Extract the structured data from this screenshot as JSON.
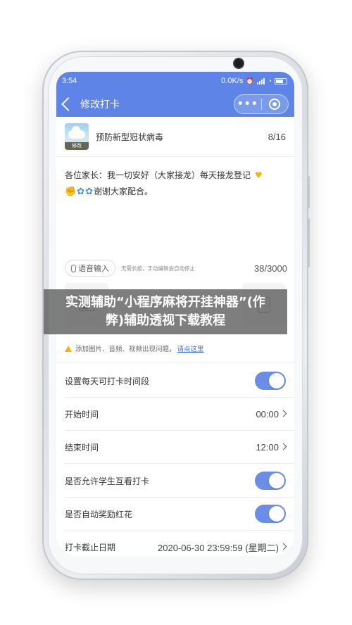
{
  "statusbar": {
    "time": "3:54",
    "network": "0.0K/s"
  },
  "header": {
    "back_icon": "chevron-left-icon",
    "title": "修改打卡",
    "more_label": "•••",
    "bg_color": "#5d84e6"
  },
  "topic": {
    "thumb_tag": "修改",
    "name": "预防新型冠状病毒",
    "count": "8/16"
  },
  "message": {
    "line1": "各位家长：我一切安好（大家接龙）每天接龙登记",
    "line2": "谢谢大家配合。"
  },
  "voice": {
    "button_label": "语音输入",
    "hint": "无需长按，手动编辑会自动停止",
    "char_count": "38/3000"
  },
  "hint": {
    "text": "添加图片、音频、视频出现问题，",
    "link": "请点这里"
  },
  "settings": [
    {
      "label": "设置每天可打卡时间段",
      "type": "toggle",
      "on": true
    },
    {
      "label": "开始时间",
      "type": "value",
      "value": "00:00"
    },
    {
      "label": "结束时间",
      "type": "value",
      "value": "12:00"
    },
    {
      "label": "是否允许学生互看打卡",
      "type": "toggle",
      "on": true
    },
    {
      "label": "是否自动奖励红花",
      "type": "toggle",
      "on": true
    },
    {
      "label": "打卡截止日期",
      "type": "value",
      "value": "2020-06-30 23:59:59 (星期二)"
    }
  ],
  "banner": {
    "line1": "实测辅助“小程序麻将开挂神器”(作",
    "line2": "弊)辅助透视下载教程"
  }
}
